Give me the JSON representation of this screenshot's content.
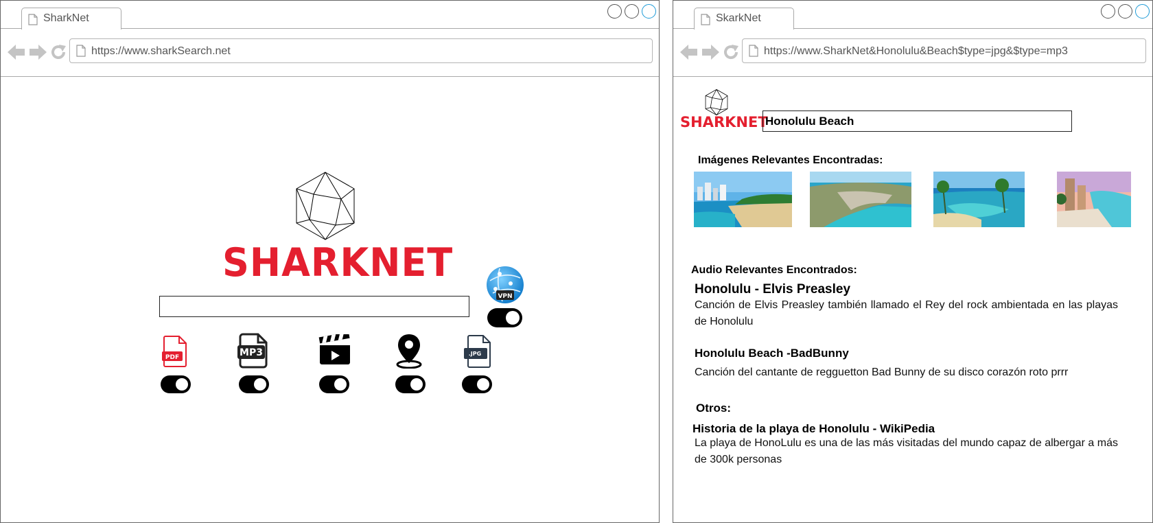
{
  "left_window": {
    "tab_title": "SharkNet",
    "url": "https://www.sharkSearch.net",
    "page": {
      "logo_text": "SHARKNET",
      "search_value": "",
      "vpn_label": "VPN",
      "vpn_toggle_on": true,
      "filters": [
        {
          "name": "pdf",
          "label": "PDF",
          "on": true
        },
        {
          "name": "mp3",
          "label": "MP3",
          "on": true
        },
        {
          "name": "video",
          "label": "",
          "on": true
        },
        {
          "name": "location",
          "label": "",
          "on": true
        },
        {
          "name": "jpg",
          "label": ".JPG",
          "on": true
        }
      ]
    }
  },
  "right_window": {
    "tab_title": "SkarkNet",
    "url": "https://www.SharkNet&Honolulu&Beach$type=jpg&$type=mp3",
    "page": {
      "logo_text": "SHARKNET",
      "search_value": "Honolulu Beach",
      "images_title": "Imágenes Relevantes Encontradas:",
      "audio_title": "Audio Relevantes Encontrados:",
      "audio_results": [
        {
          "title": "Honolulu - Elvis Preasley",
          "description": "Canción de Elvis Preasley también llamado el Rey del rock ambientada en las playas de Honolulu"
        },
        {
          "title": "Honolulu Beach -BadBunny",
          "description": "Canción del cantante de regguetton Bad Bunny de su disco corazón roto prrr"
        }
      ],
      "others_title": "Otros:",
      "other_results": [
        {
          "title": "Historia de la playa de Honolulu - WikiPedia",
          "description": "La playa de HonoLulu es una de las más visitadas del mundo capaz de albergar a más de 300k personas"
        }
      ]
    }
  },
  "colors": {
    "brand_red": "#e41f2f",
    "maximize_blue": "#1e9bd7",
    "chrome_gray": "#a9a9a9"
  }
}
